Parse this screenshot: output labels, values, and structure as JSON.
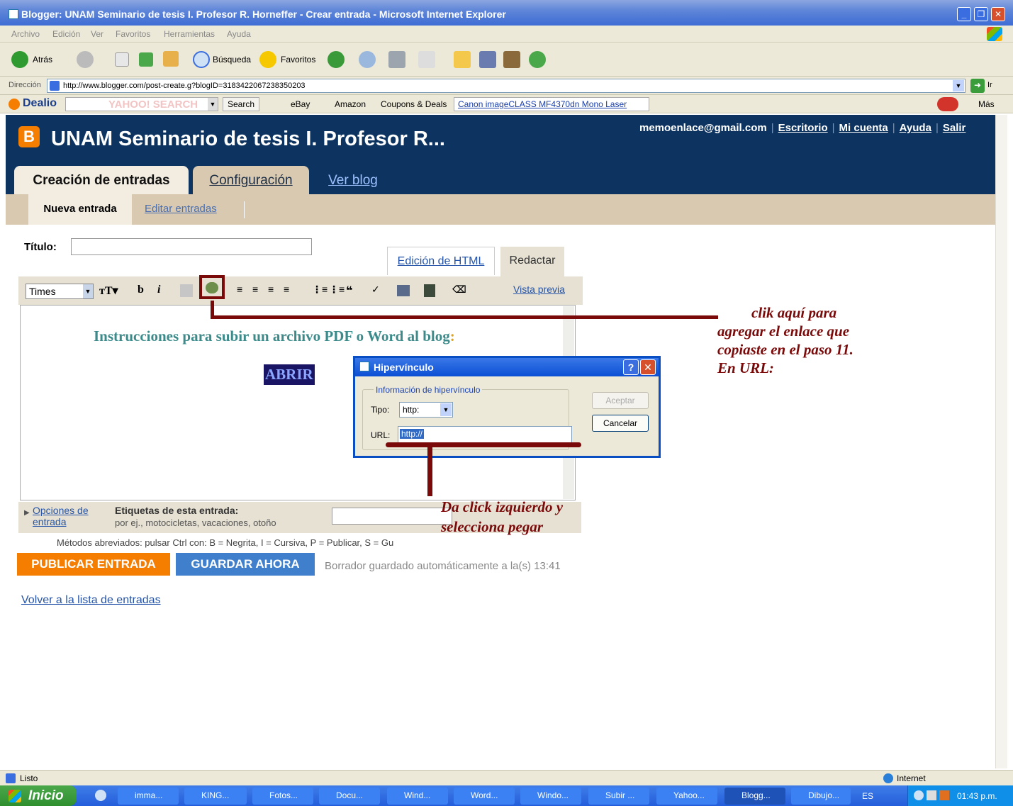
{
  "window": {
    "title": "Blogger: UNAM Seminario de tesis I. Profesor R. Horneffer - Crear entrada - Microsoft Internet Explorer"
  },
  "menu": [
    "Archivo",
    "Edición",
    "Ver",
    "Favoritos",
    "Herramientas",
    "Ayuda"
  ],
  "toolbar": {
    "back": "Atrás",
    "search": "Búsqueda",
    "favorites": "Favoritos"
  },
  "address": {
    "label": "Dirección",
    "url": "http://www.blogger.com/post-create.g?blogID=3183422067238350203",
    "go": "Ir"
  },
  "dealio": {
    "brand": "Dealio",
    "search_btn": "Search",
    "ebay": "eBay",
    "amazon": "Amazon",
    "coupons": "Coupons & Deals",
    "ad": "Canon imageCLASS MF4370dn Mono Laser",
    "mas": "Más"
  },
  "blog": {
    "title": "UNAM Seminario de tesis I. Profesor R...",
    "email": "memoenlace@gmail.com",
    "nav": [
      "Escritorio",
      "Mi cuenta",
      "Ayuda",
      "Salir"
    ],
    "tabs": [
      "Creación de entradas",
      "Configuración",
      "Ver blog"
    ],
    "subtabs": [
      "Nueva entrada",
      "Editar entradas"
    ]
  },
  "editor": {
    "titulo_label": "Título",
    "titulo_sep": ":",
    "tab_html": "Edición de HTML",
    "tab_redactar": "Redactar",
    "font": "Times",
    "bold": "b",
    "italic": "i",
    "vista_previa": "Vista previa",
    "content_heading": "Instrucciones para subir un archivo PDF o Word al blog",
    "content_heading_colon": ":",
    "content_link": "ABRIR"
  },
  "labels": {
    "opciones": "Opciones de entrada",
    "etiquetas": "Etiquetas de esta entrada:",
    "ejemplo": "por ej., motocicletas, vacaciones, otoño",
    "metodos": "Métodos abreviados: pulsar Ctrl con: B = Negrita, I = Cursiva, P = Publicar, S = Gu"
  },
  "buttons": {
    "publicar": "PUBLICAR ENTRADA",
    "guardar": "GUARDAR AHORA",
    "borrador": "Borrador guardado automáticamente a la(s) 13:41",
    "volver": "Volver a la lista de entradas"
  },
  "dialog": {
    "title": "Hipervínculo",
    "group": "Información de hipervínculo",
    "tipo_label": "Tipo:",
    "tipo_value": "http:",
    "url_label": "URL:",
    "url_value": "http://",
    "ok": "Aceptar",
    "cancel": "Cancelar"
  },
  "annotations": {
    "click_here": [
      "clik aquí para",
      "agregar el enlace que",
      "copiaste en el paso 11.",
      "En URL:"
    ],
    "paste": [
      "Da click izquierdo y",
      "selecciona pegar"
    ]
  },
  "status": {
    "left": "Listo",
    "zone": "Internet"
  },
  "taskbar": {
    "start": "Inicio",
    "tasks": [
      "imma...",
      "KING...",
      "Fotos...",
      "Docu...",
      "Wind...",
      "Word...",
      "Windo...",
      "Subir ...",
      "Yahoo...",
      "Blogg...",
      "Dibujo..."
    ],
    "lang": "ES",
    "clock": "01:43 p.m."
  },
  "colors": {
    "blogger_header": "#0d3461",
    "annotation": "#7a0a0a",
    "publish": "#f57d00",
    "save": "#3f7fcc"
  }
}
